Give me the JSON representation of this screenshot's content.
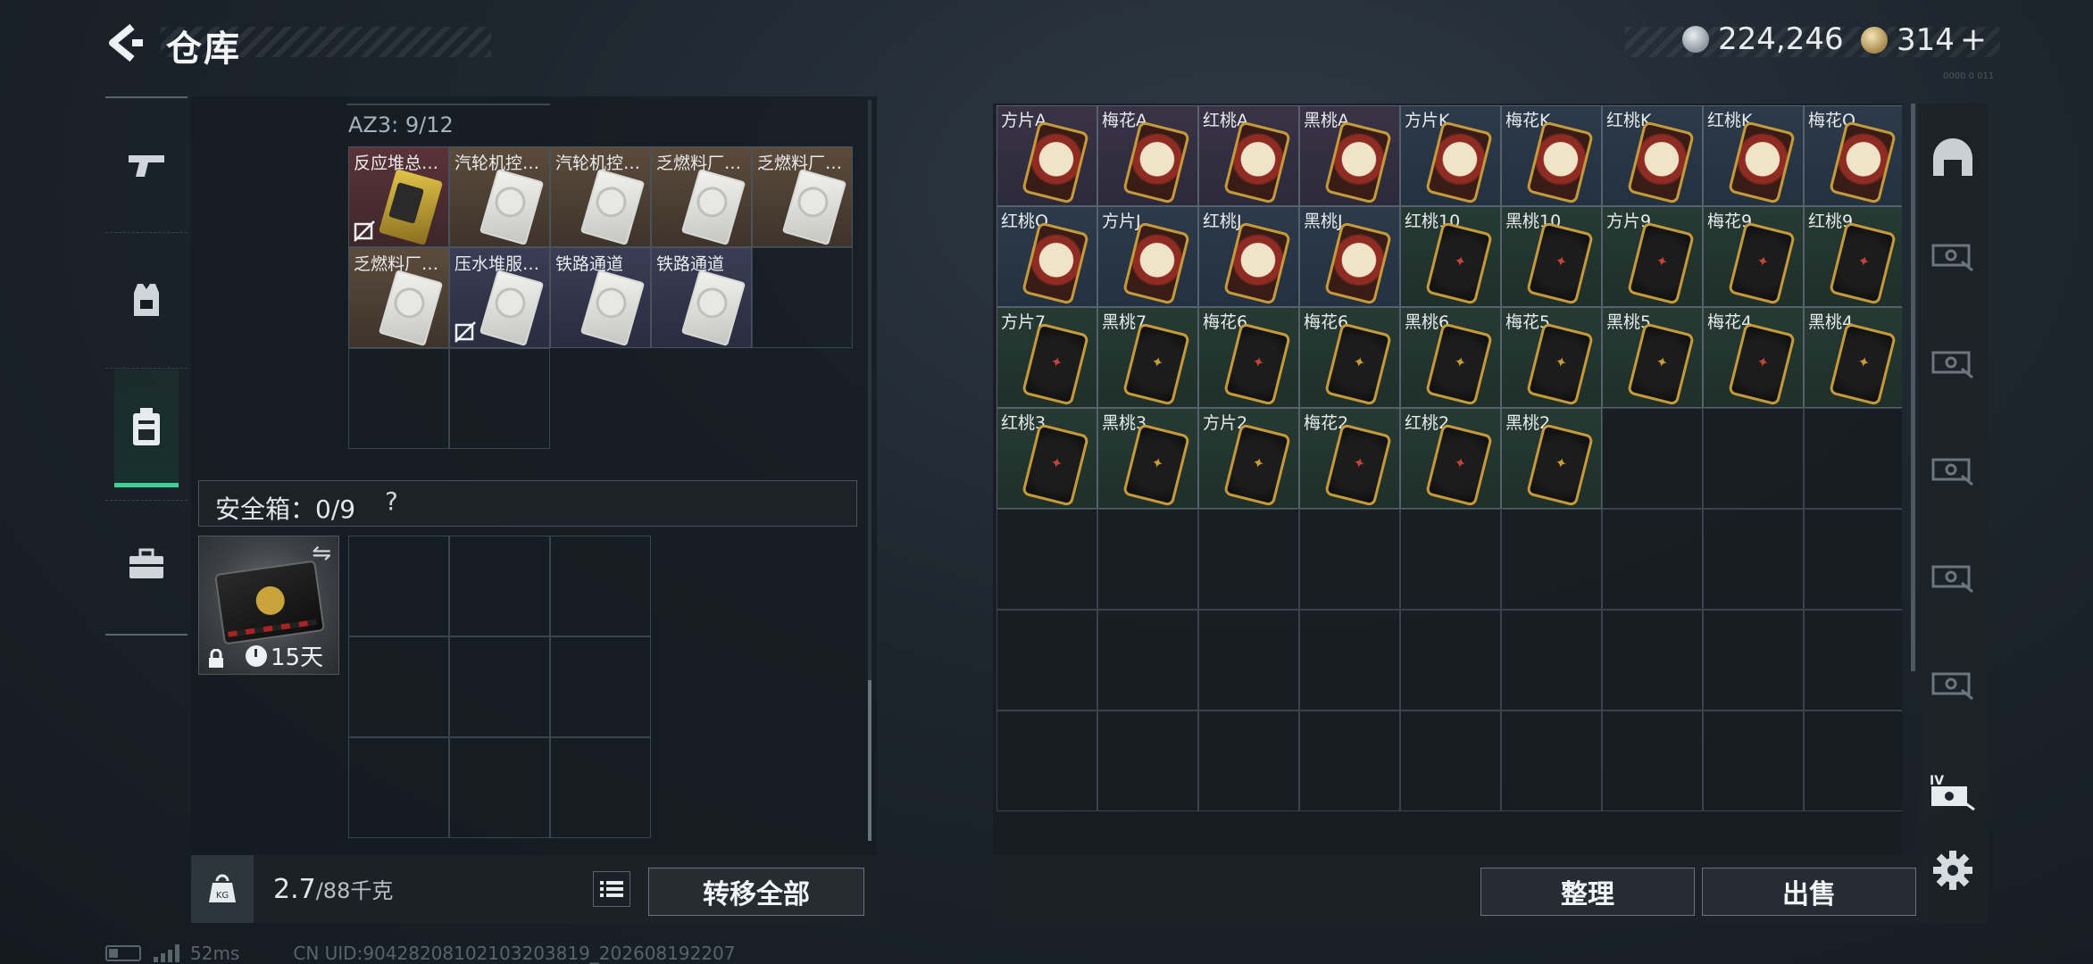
{
  "header": {
    "title": "仓库",
    "currency_silver": "224,246",
    "currency_gold": "314",
    "plus": "+",
    "code": "0000 0 011"
  },
  "left_nav": {
    "items": [
      {
        "name": "weapon",
        "icon": "gun-icon"
      },
      {
        "name": "armor",
        "icon": "vest-icon"
      },
      {
        "name": "backpack",
        "icon": "backpack-icon",
        "active": true
      },
      {
        "name": "case",
        "icon": "briefcase-icon"
      }
    ]
  },
  "backpack": {
    "container_label": "AZ3: 9/12",
    "items": [
      {
        "label": "反应堆总…",
        "color": "red",
        "art": "yellow",
        "no_trade": true
      },
      {
        "label": "汽轮机控…",
        "color": "brown",
        "art": "white",
        "no_trade": false
      },
      {
        "label": "汽轮机控…",
        "color": "brown",
        "art": "white",
        "no_trade": false
      },
      {
        "label": "乏燃料厂…",
        "color": "brown",
        "art": "white",
        "no_trade": false
      },
      {
        "label": "乏燃料厂…",
        "color": "brown",
        "art": "white",
        "no_trade": false
      },
      {
        "label": "乏燃料厂…",
        "color": "brown",
        "art": "white",
        "no_trade": false
      },
      {
        "label": "压水堆服…",
        "color": "navy",
        "art": "white",
        "no_trade": true
      },
      {
        "label": "铁路通道",
        "color": "navy",
        "art": "white",
        "no_trade": false
      },
      {
        "label": "铁路通道",
        "color": "navy",
        "art": "white",
        "no_trade": false
      }
    ]
  },
  "safebox": {
    "label": "安全箱：0/9",
    "help": "?",
    "timer": "15天",
    "swap": "⇋"
  },
  "weight": {
    "value": "2.7",
    "max": "/88",
    "unit": "千克"
  },
  "buttons": {
    "transfer_all": "转移全部",
    "sort": "整理",
    "sell": "出售"
  },
  "warehouse": {
    "items": [
      {
        "label": "方片A",
        "type": "face",
        "suit": "red"
      },
      {
        "label": "梅花A",
        "type": "face",
        "suit": "red"
      },
      {
        "label": "红桃A",
        "type": "face",
        "suit": "red"
      },
      {
        "label": "黑桃A",
        "type": "face",
        "suit": "red"
      },
      {
        "label": "方片K",
        "type": "face",
        "suit": "blue"
      },
      {
        "label": "梅花K",
        "type": "face",
        "suit": "blue"
      },
      {
        "label": "红桃K",
        "type": "face",
        "suit": "blue"
      },
      {
        "label": "红桃K",
        "type": "face",
        "suit": "blue"
      },
      {
        "label": "梅花Q",
        "type": "face",
        "suit": "blue"
      },
      {
        "label": "红桃Q",
        "type": "face",
        "suit": "blue"
      },
      {
        "label": "方片J",
        "type": "face",
        "suit": "blue"
      },
      {
        "label": "红桃J",
        "type": "face",
        "suit": "blue"
      },
      {
        "label": "黑桃J",
        "type": "face",
        "suit": "blue"
      },
      {
        "label": "红桃10",
        "type": "num",
        "suit": "red"
      },
      {
        "label": "黑桃10",
        "type": "num",
        "suit": "red"
      },
      {
        "label": "方片9",
        "type": "num",
        "suit": "red"
      },
      {
        "label": "梅花9",
        "type": "num",
        "suit": "red"
      },
      {
        "label": "红桃9",
        "type": "num",
        "suit": "red"
      },
      {
        "label": "方片7",
        "type": "num",
        "suit": "red"
      },
      {
        "label": "黑桃7",
        "type": "num",
        "suit": "gold"
      },
      {
        "label": "梅花6",
        "type": "num",
        "suit": "red"
      },
      {
        "label": "梅花6",
        "type": "num",
        "suit": "gold"
      },
      {
        "label": "黑桃6",
        "type": "num",
        "suit": "gold"
      },
      {
        "label": "梅花5",
        "type": "num",
        "suit": "gold"
      },
      {
        "label": "黑桃5",
        "type": "num",
        "suit": "gold"
      },
      {
        "label": "梅花4",
        "type": "num",
        "suit": "red"
      },
      {
        "label": "黑桃4",
        "type": "num",
        "suit": "gold"
      },
      {
        "label": "红桃3",
        "type": "num",
        "suit": "red"
      },
      {
        "label": "黑桃3",
        "type": "num",
        "suit": "gold"
      },
      {
        "label": "方片2",
        "type": "num",
        "suit": "gold"
      },
      {
        "label": "梅花2",
        "type": "num",
        "suit": "red"
      },
      {
        "label": "红桃2",
        "type": "num",
        "suit": "red"
      },
      {
        "label": "黑桃2",
        "type": "num",
        "suit": "gold"
      }
    ],
    "total_cells": 63
  },
  "right_tabs": [
    {
      "icon": "helmet-icon"
    },
    {
      "icon": "cash-icon"
    },
    {
      "icon": "cash-icon"
    },
    {
      "icon": "cash-icon"
    },
    {
      "icon": "cash-icon"
    },
    {
      "icon": "cash-icon"
    },
    {
      "icon": "cash-iv-icon",
      "badge": "IV"
    }
  ],
  "footer": {
    "ping": "52ms",
    "uid": "CN UID:9042820810210320381​9_202608192207"
  },
  "colors": {
    "accent": "#3fcf97",
    "panel": "#151b21",
    "text": "#d6dbe0"
  }
}
